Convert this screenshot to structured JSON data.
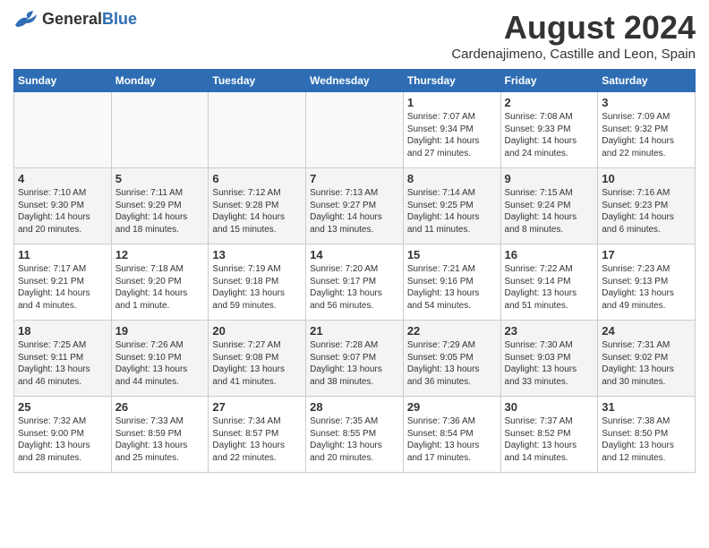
{
  "header": {
    "logo_general": "General",
    "logo_blue": "Blue",
    "month_year": "August 2024",
    "location": "Cardenajimeno, Castille and Leon, Spain"
  },
  "weekdays": [
    "Sunday",
    "Monday",
    "Tuesday",
    "Wednesday",
    "Thursday",
    "Friday",
    "Saturday"
  ],
  "weeks": [
    [
      {
        "day": "",
        "empty": true
      },
      {
        "day": "",
        "empty": true
      },
      {
        "day": "",
        "empty": true
      },
      {
        "day": "",
        "empty": true
      },
      {
        "day": "1",
        "sunrise": "Sunrise: 7:07 AM",
        "sunset": "Sunset: 9:34 PM",
        "daylight": "Daylight: 14 hours and 27 minutes."
      },
      {
        "day": "2",
        "sunrise": "Sunrise: 7:08 AM",
        "sunset": "Sunset: 9:33 PM",
        "daylight": "Daylight: 14 hours and 24 minutes."
      },
      {
        "day": "3",
        "sunrise": "Sunrise: 7:09 AM",
        "sunset": "Sunset: 9:32 PM",
        "daylight": "Daylight: 14 hours and 22 minutes."
      }
    ],
    [
      {
        "day": "4",
        "sunrise": "Sunrise: 7:10 AM",
        "sunset": "Sunset: 9:30 PM",
        "daylight": "Daylight: 14 hours and 20 minutes."
      },
      {
        "day": "5",
        "sunrise": "Sunrise: 7:11 AM",
        "sunset": "Sunset: 9:29 PM",
        "daylight": "Daylight: 14 hours and 18 minutes."
      },
      {
        "day": "6",
        "sunrise": "Sunrise: 7:12 AM",
        "sunset": "Sunset: 9:28 PM",
        "daylight": "Daylight: 14 hours and 15 minutes."
      },
      {
        "day": "7",
        "sunrise": "Sunrise: 7:13 AM",
        "sunset": "Sunset: 9:27 PM",
        "daylight": "Daylight: 14 hours and 13 minutes."
      },
      {
        "day": "8",
        "sunrise": "Sunrise: 7:14 AM",
        "sunset": "Sunset: 9:25 PM",
        "daylight": "Daylight: 14 hours and 11 minutes."
      },
      {
        "day": "9",
        "sunrise": "Sunrise: 7:15 AM",
        "sunset": "Sunset: 9:24 PM",
        "daylight": "Daylight: 14 hours and 8 minutes."
      },
      {
        "day": "10",
        "sunrise": "Sunrise: 7:16 AM",
        "sunset": "Sunset: 9:23 PM",
        "daylight": "Daylight: 14 hours and 6 minutes."
      }
    ],
    [
      {
        "day": "11",
        "sunrise": "Sunrise: 7:17 AM",
        "sunset": "Sunset: 9:21 PM",
        "daylight": "Daylight: 14 hours and 4 minutes."
      },
      {
        "day": "12",
        "sunrise": "Sunrise: 7:18 AM",
        "sunset": "Sunset: 9:20 PM",
        "daylight": "Daylight: 14 hours and 1 minute."
      },
      {
        "day": "13",
        "sunrise": "Sunrise: 7:19 AM",
        "sunset": "Sunset: 9:18 PM",
        "daylight": "Daylight: 13 hours and 59 minutes."
      },
      {
        "day": "14",
        "sunrise": "Sunrise: 7:20 AM",
        "sunset": "Sunset: 9:17 PM",
        "daylight": "Daylight: 13 hours and 56 minutes."
      },
      {
        "day": "15",
        "sunrise": "Sunrise: 7:21 AM",
        "sunset": "Sunset: 9:16 PM",
        "daylight": "Daylight: 13 hours and 54 minutes."
      },
      {
        "day": "16",
        "sunrise": "Sunrise: 7:22 AM",
        "sunset": "Sunset: 9:14 PM",
        "daylight": "Daylight: 13 hours and 51 minutes."
      },
      {
        "day": "17",
        "sunrise": "Sunrise: 7:23 AM",
        "sunset": "Sunset: 9:13 PM",
        "daylight": "Daylight: 13 hours and 49 minutes."
      }
    ],
    [
      {
        "day": "18",
        "sunrise": "Sunrise: 7:25 AM",
        "sunset": "Sunset: 9:11 PM",
        "daylight": "Daylight: 13 hours and 46 minutes."
      },
      {
        "day": "19",
        "sunrise": "Sunrise: 7:26 AM",
        "sunset": "Sunset: 9:10 PM",
        "daylight": "Daylight: 13 hours and 44 minutes."
      },
      {
        "day": "20",
        "sunrise": "Sunrise: 7:27 AM",
        "sunset": "Sunset: 9:08 PM",
        "daylight": "Daylight: 13 hours and 41 minutes."
      },
      {
        "day": "21",
        "sunrise": "Sunrise: 7:28 AM",
        "sunset": "Sunset: 9:07 PM",
        "daylight": "Daylight: 13 hours and 38 minutes."
      },
      {
        "day": "22",
        "sunrise": "Sunrise: 7:29 AM",
        "sunset": "Sunset: 9:05 PM",
        "daylight": "Daylight: 13 hours and 36 minutes."
      },
      {
        "day": "23",
        "sunrise": "Sunrise: 7:30 AM",
        "sunset": "Sunset: 9:03 PM",
        "daylight": "Daylight: 13 hours and 33 minutes."
      },
      {
        "day": "24",
        "sunrise": "Sunrise: 7:31 AM",
        "sunset": "Sunset: 9:02 PM",
        "daylight": "Daylight: 13 hours and 30 minutes."
      }
    ],
    [
      {
        "day": "25",
        "sunrise": "Sunrise: 7:32 AM",
        "sunset": "Sunset: 9:00 PM",
        "daylight": "Daylight: 13 hours and 28 minutes."
      },
      {
        "day": "26",
        "sunrise": "Sunrise: 7:33 AM",
        "sunset": "Sunset: 8:59 PM",
        "daylight": "Daylight: 13 hours and 25 minutes."
      },
      {
        "day": "27",
        "sunrise": "Sunrise: 7:34 AM",
        "sunset": "Sunset: 8:57 PM",
        "daylight": "Daylight: 13 hours and 22 minutes."
      },
      {
        "day": "28",
        "sunrise": "Sunrise: 7:35 AM",
        "sunset": "Sunset: 8:55 PM",
        "daylight": "Daylight: 13 hours and 20 minutes."
      },
      {
        "day": "29",
        "sunrise": "Sunrise: 7:36 AM",
        "sunset": "Sunset: 8:54 PM",
        "daylight": "Daylight: 13 hours and 17 minutes."
      },
      {
        "day": "30",
        "sunrise": "Sunrise: 7:37 AM",
        "sunset": "Sunset: 8:52 PM",
        "daylight": "Daylight: 13 hours and 14 minutes."
      },
      {
        "day": "31",
        "sunrise": "Sunrise: 7:38 AM",
        "sunset": "Sunset: 8:50 PM",
        "daylight": "Daylight: 13 hours and 12 minutes."
      }
    ]
  ]
}
